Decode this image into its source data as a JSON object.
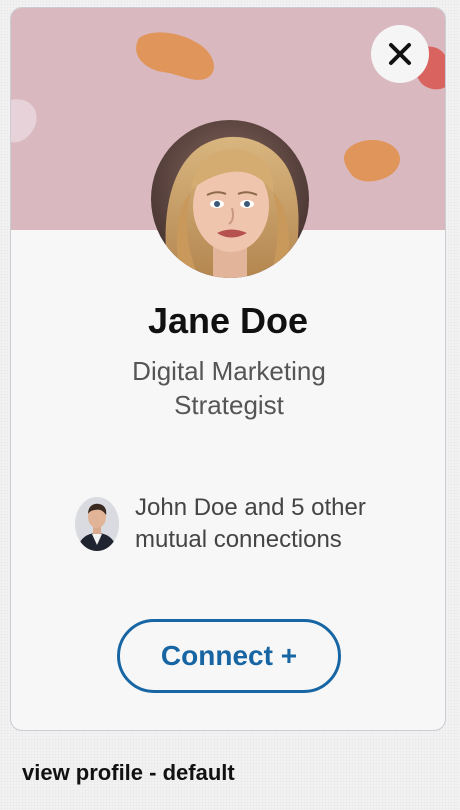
{
  "profile_card": {
    "name": "Jane Doe",
    "headline": "Digital Marketing Strategist",
    "mutual_text": "John Doe and 5 other mutual connections",
    "connect_label": "Connect +",
    "close_symbol": "✕",
    "avatar_icon": "profile-photo-woman",
    "mutual_avatar_icon": "profile-photo-man"
  },
  "caption": "view profile - default",
  "colors": {
    "banner": "#d9b8bf",
    "accent": "#1765a3",
    "blob_orange": "#e0955a",
    "blob_red": "#d9635f"
  }
}
